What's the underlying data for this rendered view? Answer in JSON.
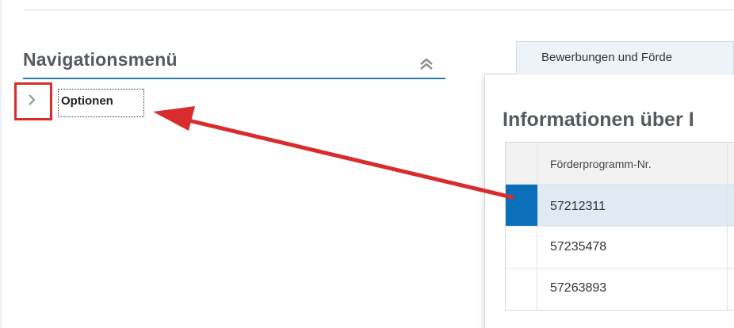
{
  "navigation": {
    "title": "Navigationsmenü",
    "expand_icon": "chevron-right-icon",
    "collapse_icon": "double-chevron-up-icon",
    "items": [
      {
        "label": "Optionen"
      }
    ]
  },
  "tabs": [
    {
      "label": "Bewerbungen und Förde"
    }
  ],
  "panel": {
    "title": "Informationen über I"
  },
  "table": {
    "columns": [
      "Förderprogramm-Nr."
    ],
    "rows": [
      {
        "program_no": "57212311",
        "selected": true
      },
      {
        "program_no": "57235478",
        "selected": false
      },
      {
        "program_no": "57263893",
        "selected": false
      }
    ]
  },
  "colors": {
    "accent": "#2a7cb9",
    "selection": "#0a6fb8",
    "selected_row": "#dfeaf2",
    "annotation": "#d92c2c"
  }
}
